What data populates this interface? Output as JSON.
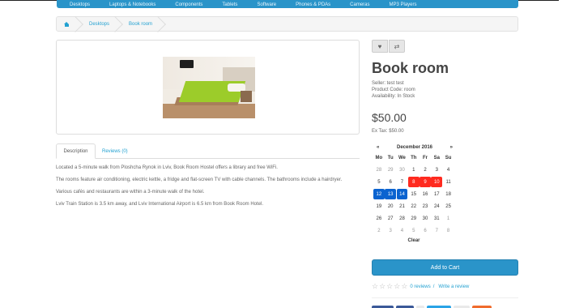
{
  "nav": {
    "items": [
      "Desktops",
      "Laptops & Notebooks",
      "Components",
      "Tablets",
      "Software",
      "Phones & PDAs",
      "Cameras",
      "MP3 Players"
    ]
  },
  "breadcrumb": {
    "items": [
      "Desktops",
      "Book room"
    ]
  },
  "tabs": {
    "description": "Description",
    "reviews": "Reviews (0)"
  },
  "description": {
    "p1": "Located a 5-minute walk from Ploshcha Rynok in Lviv, Book Room Hostel offers a library and free WiFi.",
    "p2": "The rooms feature air conditioning, electric kettle, a fridge and flat-screen TV with cable channels. The bathrooms include a hairdryer.",
    "p3": "Various cafés and restaurants are within a 3-minute walk of the hotel.",
    "p4": "Lviv Train Station is 3.5 km away, and Lviv International Airport is 6.5 km from Book Room Hotel."
  },
  "product": {
    "title": "Book room",
    "seller": "Seller: test test",
    "code": "Product Code: room",
    "availability": "Availability: In Stock",
    "price": "$50.00",
    "ex_tax": "Ex Tax: $50.00"
  },
  "calendar": {
    "prev": "«",
    "next": "»",
    "month": "December 2016",
    "dows": [
      "Mo",
      "Tu",
      "We",
      "Th",
      "Fr",
      "Sa",
      "Su"
    ],
    "weeks": [
      [
        {
          "d": "28",
          "s": "muted"
        },
        {
          "d": "29",
          "s": "muted"
        },
        {
          "d": "30",
          "s": "muted"
        },
        {
          "d": "1",
          "s": ""
        },
        {
          "d": "2",
          "s": ""
        },
        {
          "d": "3",
          "s": ""
        },
        {
          "d": "4",
          "s": ""
        }
      ],
      [
        {
          "d": "5",
          "s": ""
        },
        {
          "d": "6",
          "s": ""
        },
        {
          "d": "7",
          "s": ""
        },
        {
          "d": "8",
          "s": "red"
        },
        {
          "d": "9",
          "s": "red"
        },
        {
          "d": "10",
          "s": "red"
        },
        {
          "d": "11",
          "s": ""
        }
      ],
      [
        {
          "d": "12",
          "s": "blue"
        },
        {
          "d": "13",
          "s": "blue"
        },
        {
          "d": "14",
          "s": "blue"
        },
        {
          "d": "15",
          "s": ""
        },
        {
          "d": "16",
          "s": ""
        },
        {
          "d": "17",
          "s": ""
        },
        {
          "d": "18",
          "s": ""
        }
      ],
      [
        {
          "d": "19",
          "s": ""
        },
        {
          "d": "20",
          "s": ""
        },
        {
          "d": "21",
          "s": ""
        },
        {
          "d": "22",
          "s": ""
        },
        {
          "d": "23",
          "s": ""
        },
        {
          "d": "24",
          "s": ""
        },
        {
          "d": "25",
          "s": ""
        }
      ],
      [
        {
          "d": "26",
          "s": ""
        },
        {
          "d": "27",
          "s": ""
        },
        {
          "d": "28",
          "s": ""
        },
        {
          "d": "29",
          "s": ""
        },
        {
          "d": "30",
          "s": ""
        },
        {
          "d": "31",
          "s": ""
        },
        {
          "d": "1",
          "s": "muted"
        }
      ],
      [
        {
          "d": "2",
          "s": "muted"
        },
        {
          "d": "3",
          "s": "muted"
        },
        {
          "d": "4",
          "s": "muted"
        },
        {
          "d": "5",
          "s": "muted"
        },
        {
          "d": "6",
          "s": "muted"
        },
        {
          "d": "7",
          "s": "muted"
        },
        {
          "d": "8",
          "s": "muted"
        }
      ]
    ],
    "clear": "Clear"
  },
  "cart": {
    "label": "Add to Cart"
  },
  "reviews": {
    "count_link": "0 reviews",
    "sep": "/",
    "write_link": "Write a review",
    "stars": 0
  },
  "colors": {
    "accent": "#2a94c9",
    "link": "#23a1d1",
    "booked": "#ff2a1f",
    "selected": "#0a63d0"
  },
  "icons": {
    "home": "home-icon",
    "wishlist": "heart-icon",
    "compare": "compare-icon",
    "star": "star-icon"
  }
}
